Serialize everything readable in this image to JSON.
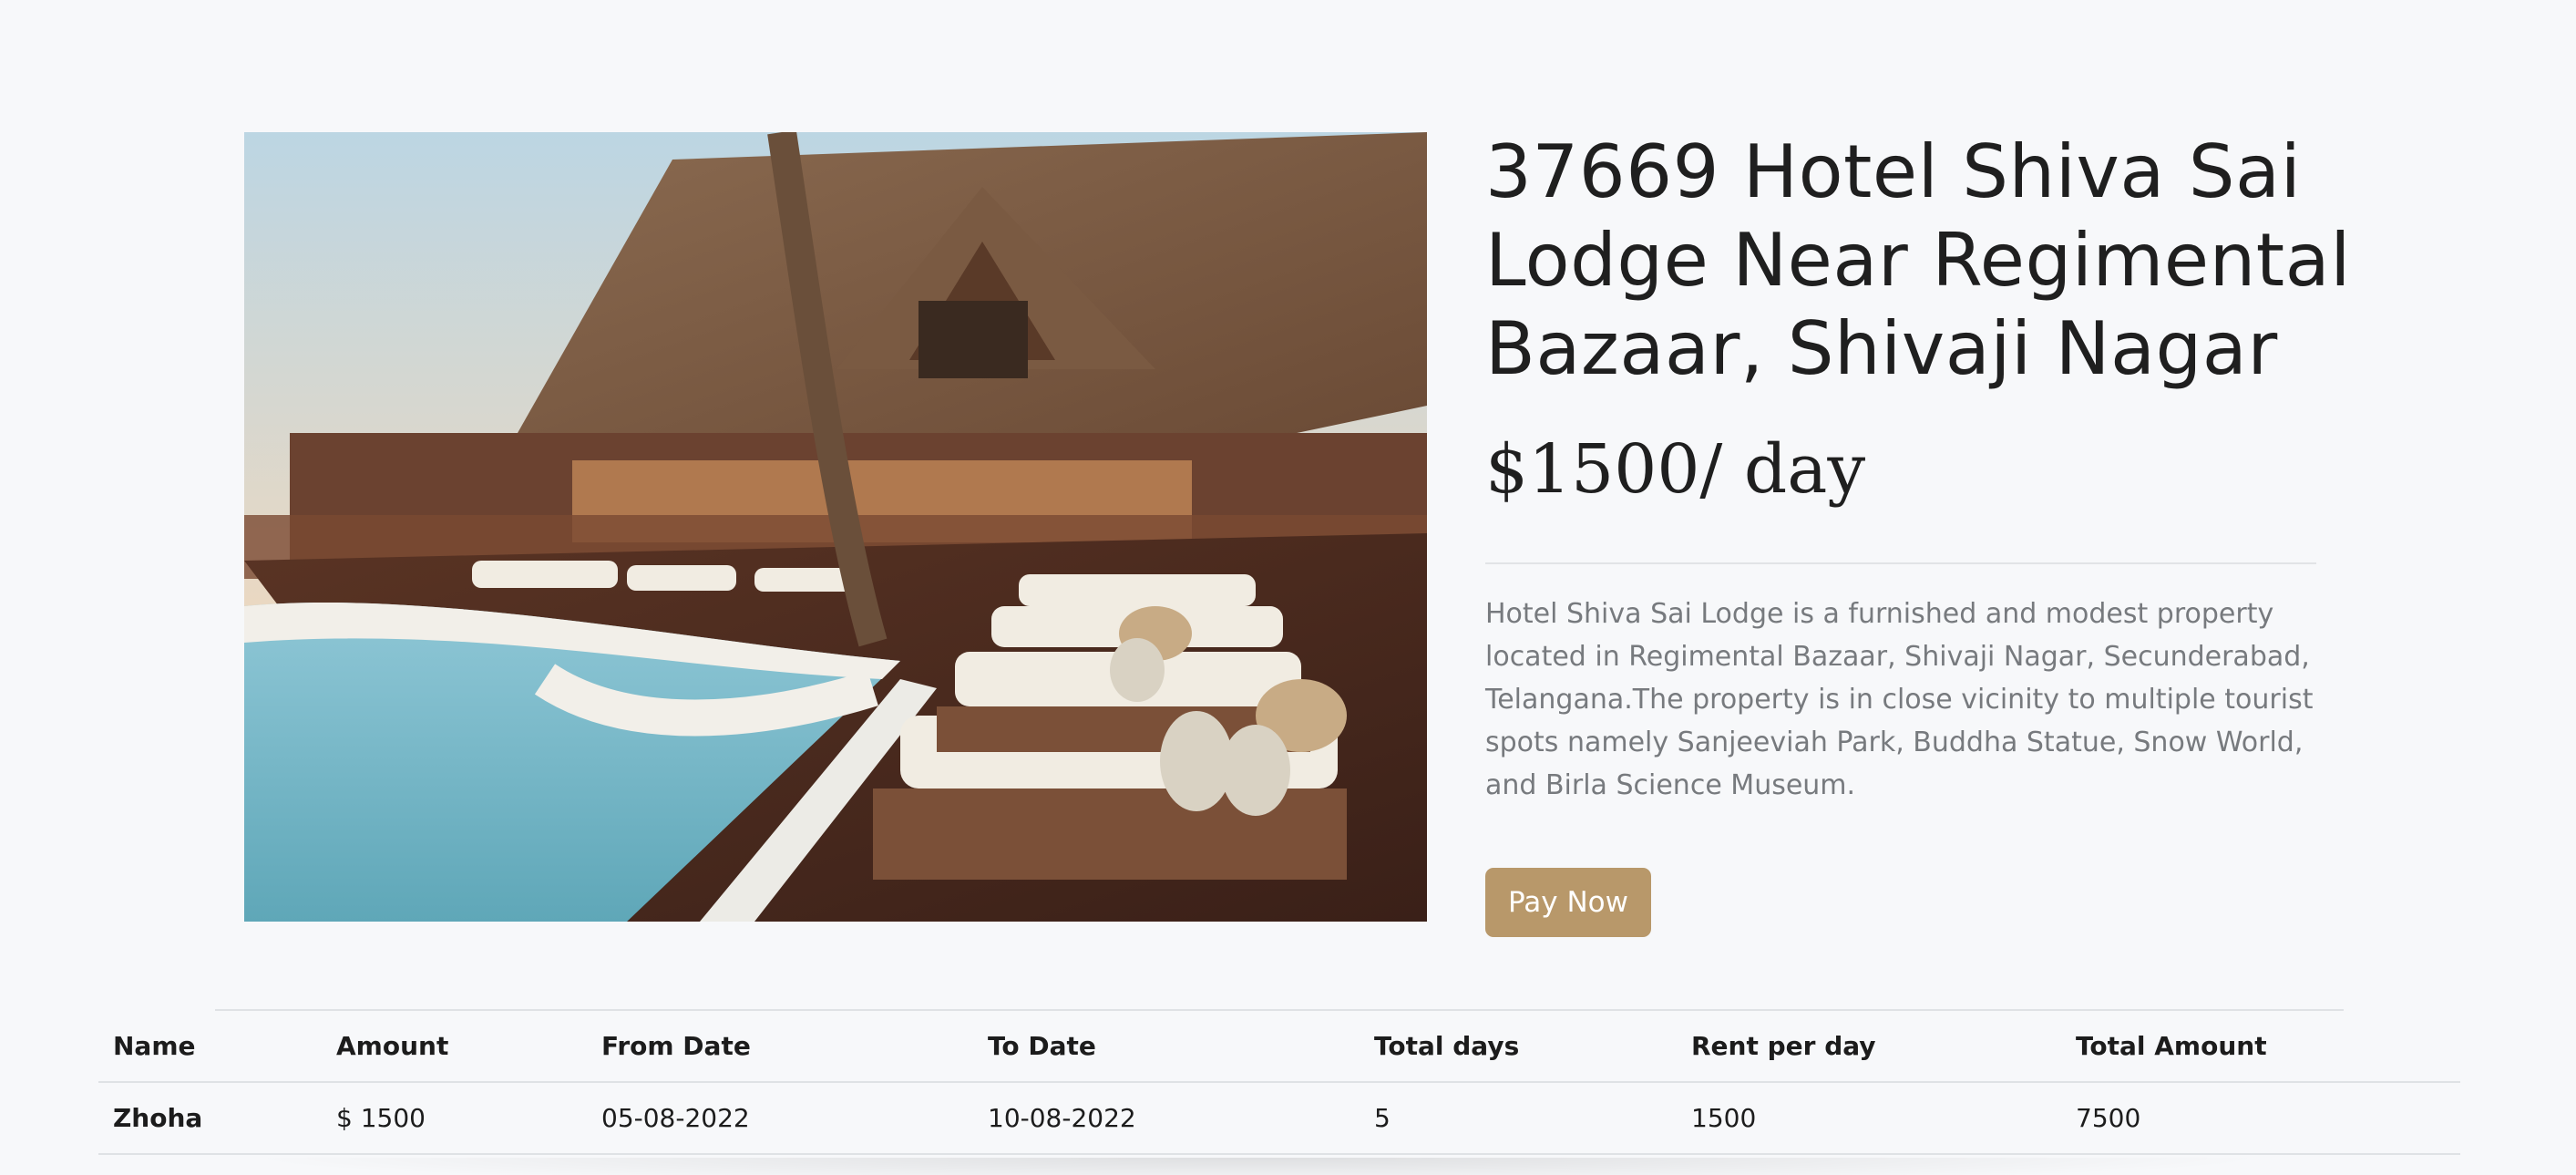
{
  "hotel": {
    "title": "37669 Hotel Shiva Sai Lodge Near Regimental Bazaar, Shivaji Nagar",
    "price": "$1500/ day",
    "description": "Hotel Shiva Sai Lodge is a furnished and modest property located in Regimental Bazaar, Shivaji Nagar, Secunderabad, Telangana.The property is in close vicinity to multiple tourist spots namely Sanjeeviah Park, Buddha Statue, Snow World, and Birla Science Museum.",
    "pay_label": "Pay Now",
    "accent_color": "#b8986a"
  },
  "booking_table": {
    "headers": {
      "name": "Name",
      "amount": "Amount",
      "from_date": "From Date",
      "to_date": "To Date",
      "total_days": "Total days",
      "rent_per_day": "Rent per day",
      "total_amount": "Total Amount"
    },
    "rows": [
      {
        "name": "Zhoha",
        "amount": "$ 1500",
        "from_date": "05-08-2022",
        "to_date": "10-08-2022",
        "total_days": "5",
        "rent_per_day": "1500",
        "total_amount": "7500"
      }
    ]
  }
}
